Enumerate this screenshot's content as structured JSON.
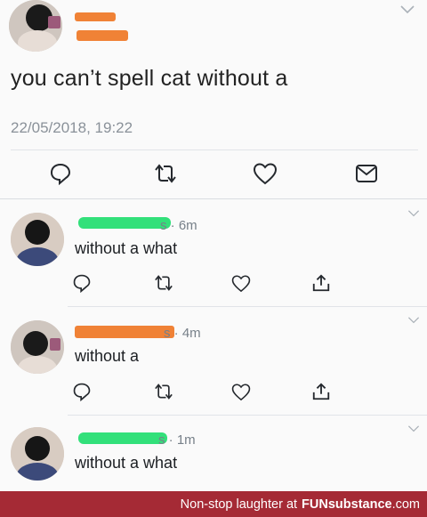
{
  "main_tweet": {
    "text": "you can’t spell cat without a",
    "timestamp": "22/05/2018, 19:22",
    "actions": [
      "reply-icon",
      "retweet-icon",
      "like-icon",
      "message-icon"
    ],
    "redaction_color": "#f08236"
  },
  "replies": [
    {
      "handle_suffix": "s · 6m",
      "text": "without a what",
      "redaction_color": "#32e07a"
    },
    {
      "handle_suffix": "s · 4m",
      "text": "without a",
      "redaction_color": "#f08236"
    },
    {
      "handle_suffix": "s · 1m",
      "text": "without a what",
      "redaction_color": "#32e07a"
    }
  ],
  "reply_actions": [
    "reply-icon",
    "retweet-icon",
    "like-icon",
    "share-icon"
  ],
  "watermark": {
    "prefix": "Non-stop laughter at",
    "brand_bold": "FUNsubstance",
    "brand_suffix": ".com",
    "background": "#a52a35"
  }
}
